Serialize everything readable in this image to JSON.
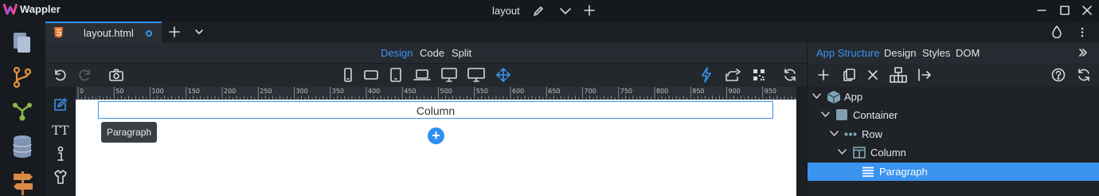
{
  "app": {
    "name": "Wappler"
  },
  "window": {
    "title": "layout"
  },
  "file_tab": {
    "label": "layout.html",
    "icon": "html5-icon"
  },
  "view_modes": [
    {
      "label": "Design",
      "active": true
    },
    {
      "label": "Code",
      "active": false
    },
    {
      "label": "Split",
      "active": false
    }
  ],
  "ruler": {
    "labels": [
      "0",
      "50",
      "100",
      "150",
      "200",
      "250",
      "300",
      "350",
      "400",
      "450",
      "500",
      "550",
      "600",
      "650",
      "700",
      "750",
      "800",
      "850",
      "900",
      "950"
    ]
  },
  "canvas": {
    "column_text": "Column",
    "tooltip": "Paragraph"
  },
  "right_panel": {
    "tabs": [
      {
        "label": "App Structure",
        "active": true
      },
      {
        "label": "Design",
        "active": false
      },
      {
        "label": "Styles",
        "active": false
      },
      {
        "label": "DOM",
        "active": false
      }
    ],
    "tree": [
      {
        "label": "App",
        "icon": "cube-icon",
        "selected": false
      },
      {
        "label": "Container",
        "icon": "square-icon",
        "selected": false
      },
      {
        "label": "Row",
        "icon": "dots-icon",
        "selected": false
      },
      {
        "label": "Column",
        "icon": "columns-icon",
        "selected": false
      },
      {
        "label": "Paragraph",
        "icon": "paragraph-icon",
        "selected": true
      }
    ]
  },
  "colors": {
    "accent": "#3b93f0",
    "selection": "#3b93f0",
    "canvas_bg": "#ffffff"
  }
}
